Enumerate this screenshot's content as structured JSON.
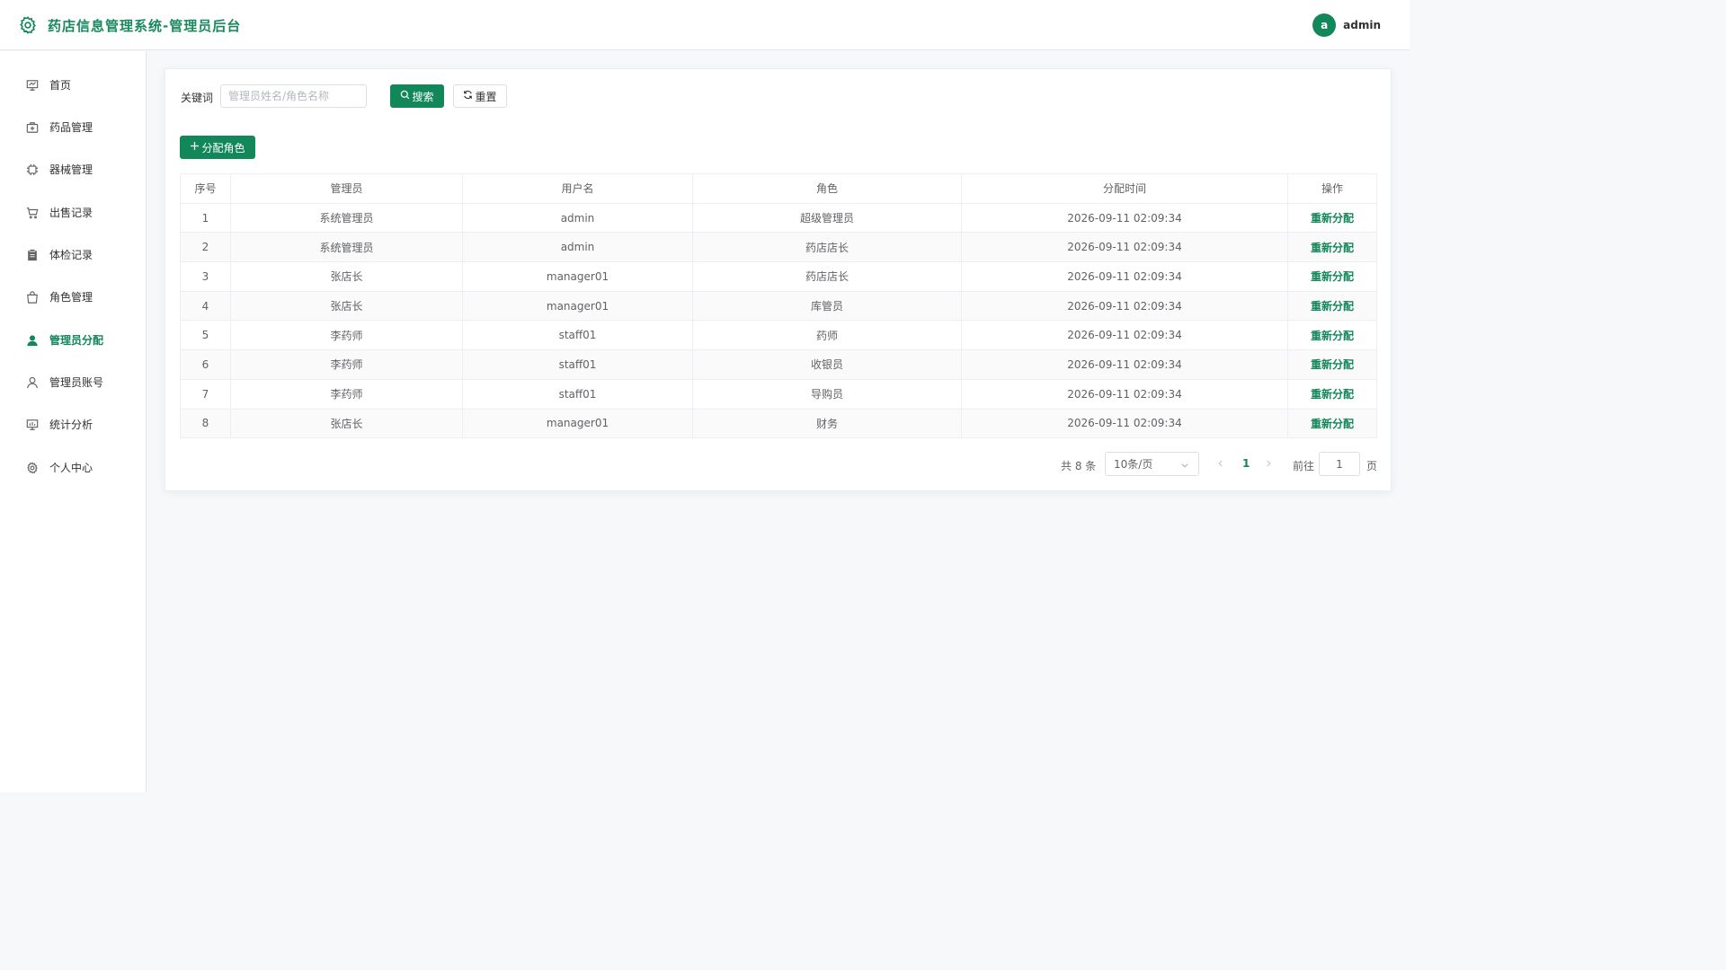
{
  "header": {
    "title": "药店信息管理系统-管理员后台",
    "avatar_letter": "a",
    "user_name": "admin"
  },
  "sidebar": {
    "items": [
      {
        "label": "首页",
        "icon": "dashboard-icon",
        "active": false
      },
      {
        "label": "药品管理",
        "icon": "medicine-box-icon",
        "active": false
      },
      {
        "label": "器械管理",
        "icon": "chip-icon",
        "active": false
      },
      {
        "label": "出售记录",
        "icon": "cart-icon",
        "active": false
      },
      {
        "label": "体检记录",
        "icon": "clipboard-icon",
        "active": false
      },
      {
        "label": "角色管理",
        "icon": "bag-icon",
        "active": false
      },
      {
        "label": "管理员分配",
        "icon": "user-filled-icon",
        "active": true
      },
      {
        "label": "管理员账号",
        "icon": "user-icon",
        "active": false
      },
      {
        "label": "统计分析",
        "icon": "chart-icon",
        "active": false
      },
      {
        "label": "个人中心",
        "icon": "gear-icon",
        "active": false
      }
    ]
  },
  "search": {
    "label": "关键词",
    "placeholder": "管理员姓名/角色名称",
    "value": "",
    "search_button": "搜索",
    "reset_button": "重置"
  },
  "assign_button": "分配角色",
  "table": {
    "columns": [
      "序号",
      "管理员",
      "用户名",
      "角色",
      "分配时间",
      "操作"
    ],
    "rows": [
      {
        "no": "1",
        "admin": "系统管理员",
        "username": "admin",
        "role": "超级管理员",
        "time": "2026-09-11 02:09:34",
        "action": "重新分配"
      },
      {
        "no": "2",
        "admin": "系统管理员",
        "username": "admin",
        "role": "药店店长",
        "time": "2026-09-11 02:09:34",
        "action": "重新分配"
      },
      {
        "no": "3",
        "admin": "张店长",
        "username": "manager01",
        "role": "药店店长",
        "time": "2026-09-11 02:09:34",
        "action": "重新分配"
      },
      {
        "no": "4",
        "admin": "张店长",
        "username": "manager01",
        "role": "库管员",
        "time": "2026-09-11 02:09:34",
        "action": "重新分配"
      },
      {
        "no": "5",
        "admin": "李药师",
        "username": "staff01",
        "role": "药师",
        "time": "2026-09-11 02:09:34",
        "action": "重新分配"
      },
      {
        "no": "6",
        "admin": "李药师",
        "username": "staff01",
        "role": "收银员",
        "time": "2026-09-11 02:09:34",
        "action": "重新分配"
      },
      {
        "no": "7",
        "admin": "李药师",
        "username": "staff01",
        "role": "导购员",
        "time": "2026-09-11 02:09:34",
        "action": "重新分配"
      },
      {
        "no": "8",
        "admin": "张店长",
        "username": "manager01",
        "role": "财务",
        "time": "2026-09-11 02:09:34",
        "action": "重新分配"
      }
    ]
  },
  "pagination": {
    "total_text": "共 8 条",
    "page_size": "10条/页",
    "current_page": "1",
    "goto_label": "前往",
    "goto_value": "1",
    "goto_suffix": "页"
  },
  "colors": {
    "accent": "#12875a",
    "title": "#1a8a5e"
  }
}
